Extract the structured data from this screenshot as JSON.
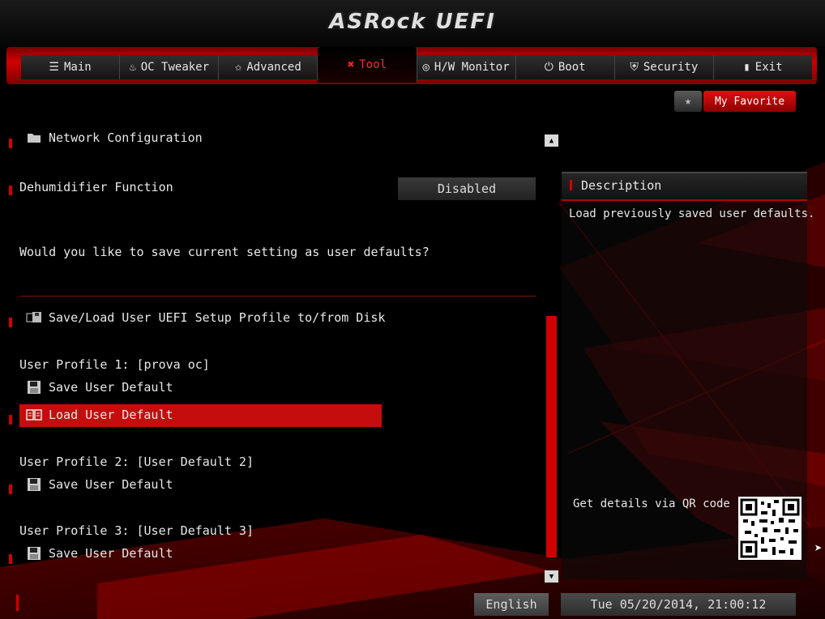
{
  "app": {
    "title": "ASRock UEFI"
  },
  "tabs": [
    {
      "label": "Main",
      "icon": "list-icon",
      "glyph": "☰"
    },
    {
      "label": "OC Tweaker",
      "icon": "flame-icon",
      "glyph": "♨"
    },
    {
      "label": "Advanced",
      "icon": "star-icon",
      "glyph": "✩"
    },
    {
      "label": "Tool",
      "icon": "tool-icon",
      "glyph": "✖",
      "active": true
    },
    {
      "label": "H/W Monitor",
      "icon": "monitor-icon",
      "glyph": "◎"
    },
    {
      "label": "Boot",
      "icon": "power-icon",
      "glyph": "⏻"
    },
    {
      "label": "Security",
      "icon": "shield-icon",
      "glyph": "⛨"
    },
    {
      "label": "Exit",
      "icon": "exit-icon",
      "glyph": "▮"
    }
  ],
  "favorite": {
    "label": "My Favorite",
    "star": "★"
  },
  "items": {
    "network": "Network Configuration",
    "dehumidifier_label": "Dehumidifier Function",
    "dehumidifier_value": "Disabled",
    "question": "Would you like to save current setting as user defaults?",
    "profile_section": "Save/Load User UEFI Setup Profile to/from Disk",
    "profile1": "User Profile 1: [prova oc]",
    "profile1_save": "Save User Default",
    "profile1_load": "Load User Default",
    "profile2": "User Profile 2: [User Default 2]",
    "profile2_save": "Save User Default",
    "profile3": "User Profile 3: [User Default 3]",
    "profile3_save": "Save User Default"
  },
  "description": {
    "title": "Description",
    "text": "Load previously saved user defaults.",
    "qr_label": "Get details via QR code"
  },
  "footer": {
    "language": "English",
    "datetime": "Tue 05/20/2014, 21:00:12"
  },
  "colors": {
    "accent": "#d00000",
    "selected": "#c50d0d"
  }
}
